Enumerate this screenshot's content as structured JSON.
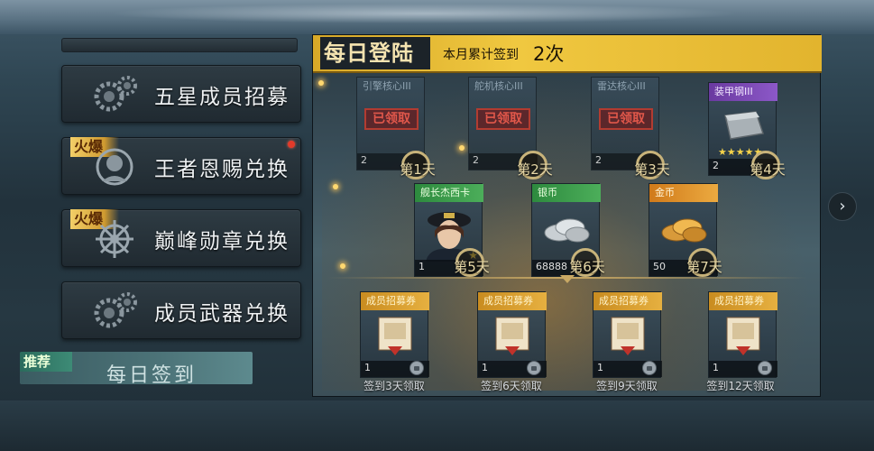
{
  "menu": {
    "items": [
      {
        "label": "五星成员招募",
        "icon": "gear-icon"
      },
      {
        "label": "王者恩赐兑换",
        "icon": "face-icon",
        "tag": "火爆"
      },
      {
        "label": "巅峰勋章兑换",
        "icon": "ship-wheel-icon",
        "tag": "火爆"
      },
      {
        "label": "成员武器兑换",
        "icon": "gear-icon"
      }
    ],
    "selected": {
      "tag": "推荐",
      "label": "每日签到"
    }
  },
  "panel": {
    "title": "每日登陆",
    "subtitle": "本月累计签到",
    "count": "2次",
    "rewards": [
      {
        "name": "引擎核心III",
        "qty": "2",
        "day": "第1天",
        "claimed_label": "已领取",
        "status": "claimed"
      },
      {
        "name": "舵机核心III",
        "qty": "2",
        "day": "第2天",
        "claimed_label": "已领取",
        "status": "claimed"
      },
      {
        "name": "雷达核心III",
        "qty": "2",
        "day": "第3天",
        "claimed_label": "已领取",
        "status": "claimed"
      },
      {
        "name": "装甲钢III",
        "qty": "2",
        "day": "第4天",
        "stars": "★★★★★",
        "status": "available"
      },
      {
        "name": "舰长杰西卡",
        "qty": "1",
        "day": "第5天",
        "star": "★",
        "status": "available"
      },
      {
        "name": "银币",
        "qty": "68888",
        "day": "第6天",
        "status": "available"
      },
      {
        "name": "金币",
        "qty": "50",
        "day": "第7天",
        "status": "available"
      }
    ],
    "tickets": [
      {
        "name": "成员招募券",
        "qty": "1",
        "foot": "签到3天领取"
      },
      {
        "name": "成员招募券",
        "qty": "1",
        "foot": "签到6天领取"
      },
      {
        "name": "成员招募券",
        "qty": "1",
        "foot": "签到9天领取"
      },
      {
        "name": "成员招募券",
        "qty": "1",
        "foot": "签到12天领取"
      }
    ]
  },
  "nav": {
    "next_label": "›"
  },
  "colors": {
    "gold": "#e6b040",
    "claimed_red": "#c83a2c",
    "panel_header": "#f0c840"
  }
}
